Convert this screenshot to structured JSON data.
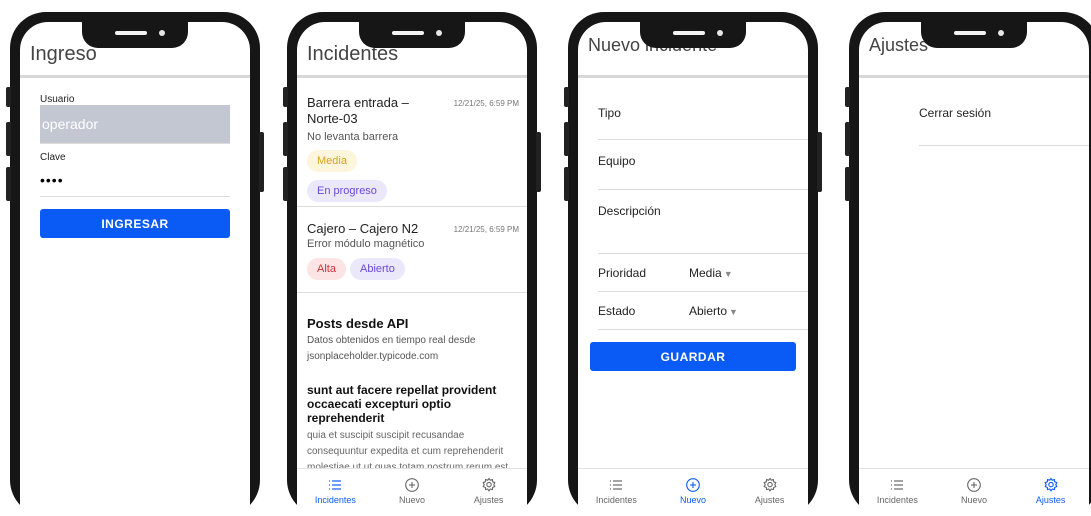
{
  "login": {
    "title": "Ingreso",
    "user_label": "Usuario",
    "user_value": "operador",
    "pass_label": "Clave",
    "pass_value": "••••",
    "submit_label": "INGRESAR"
  },
  "incidents": {
    "title": "Incidentes",
    "items": [
      {
        "title": "Barrera entrada – Norte-03",
        "time": "12/21/25, 6:59 PM",
        "description": "No levanta barrera",
        "priority": "Media",
        "status": "En progreso"
      },
      {
        "title": "Cajero – Cajero N2",
        "time": "12/21/25, 6:59 PM",
        "description": "Error módulo magnético",
        "priority": "Alta",
        "status": "Abierto"
      }
    ],
    "posts_title": "Posts desde API",
    "posts_subtitle": "Datos obtenidos en tiempo real desde jsonplaceholder.typicode.com",
    "post": {
      "title": "sunt aut facere repellat provident occaecati excepturi optio reprehenderit",
      "body": "quia et suscipit suscipit recusandae consequuntur expedita et cum reprehenderit molestiae ut ut quas totam nostrum rerum est"
    }
  },
  "new_incident": {
    "title": "Nuevo incidente",
    "type_label": "Tipo",
    "equipment_label": "Equipo",
    "description_label": "Descripción",
    "priority_label": "Prioridad",
    "priority_value": "Media",
    "status_label": "Estado",
    "status_value": "Abierto",
    "save_label": "GUARDAR"
  },
  "settings": {
    "title": "Ajustes",
    "logout_label": "Cerrar sesión"
  },
  "nav": {
    "incidents": "Incidentes",
    "new": "Nuevo",
    "settings": "Ajustes"
  },
  "icons": {
    "list": "list-icon",
    "add": "add-circle-icon",
    "settings": "gear-icon",
    "dropdown": "caret-down-icon"
  },
  "colors": {
    "primary": "#0a5bf5",
    "frame": "#161616",
    "chip_media_bg": "#fdf6dc",
    "chip_media_text": "#d8a31a",
    "chip_alta_bg": "#fde4e4",
    "chip_alta_text": "#d0303a",
    "chip_status_bg": "#ece8fb",
    "chip_status_text": "#6a48d8"
  }
}
